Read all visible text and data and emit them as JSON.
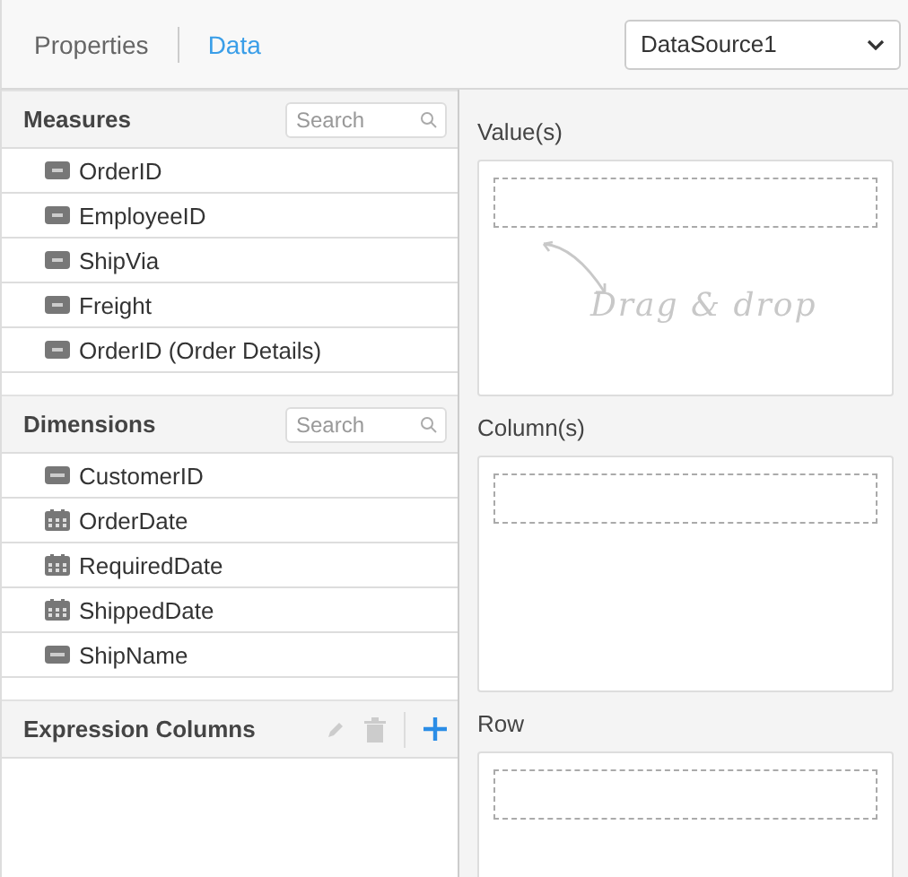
{
  "tabs": [
    {
      "label": "Properties",
      "selected": false
    },
    {
      "label": "Data",
      "selected": true
    }
  ],
  "datasource": {
    "value": "DataSource1"
  },
  "measures": {
    "title": "Measures",
    "search": {
      "placeholder": "Search"
    },
    "items": [
      {
        "label": "OrderID",
        "kind": "number"
      },
      {
        "label": "EmployeeID",
        "kind": "number"
      },
      {
        "label": "ShipVia",
        "kind": "number"
      },
      {
        "label": "Freight",
        "kind": "number"
      },
      {
        "label": "OrderID (Order Details)",
        "kind": "number"
      }
    ]
  },
  "dimensions": {
    "title": "Dimensions",
    "search": {
      "placeholder": "Search"
    },
    "items": [
      {
        "label": "CustomerID",
        "kind": "string"
      },
      {
        "label": "OrderDate",
        "kind": "date"
      },
      {
        "label": "RequiredDate",
        "kind": "date"
      },
      {
        "label": "ShippedDate",
        "kind": "date"
      },
      {
        "label": "ShipName",
        "kind": "string"
      }
    ]
  },
  "expression_columns": {
    "title": "Expression Columns",
    "edit_disabled": true,
    "delete_disabled": true
  },
  "drop_zones": [
    {
      "label": "Value(s)",
      "hint": "Drag & drop"
    },
    {
      "label": "Column(s)"
    },
    {
      "label": "Row"
    }
  ]
}
